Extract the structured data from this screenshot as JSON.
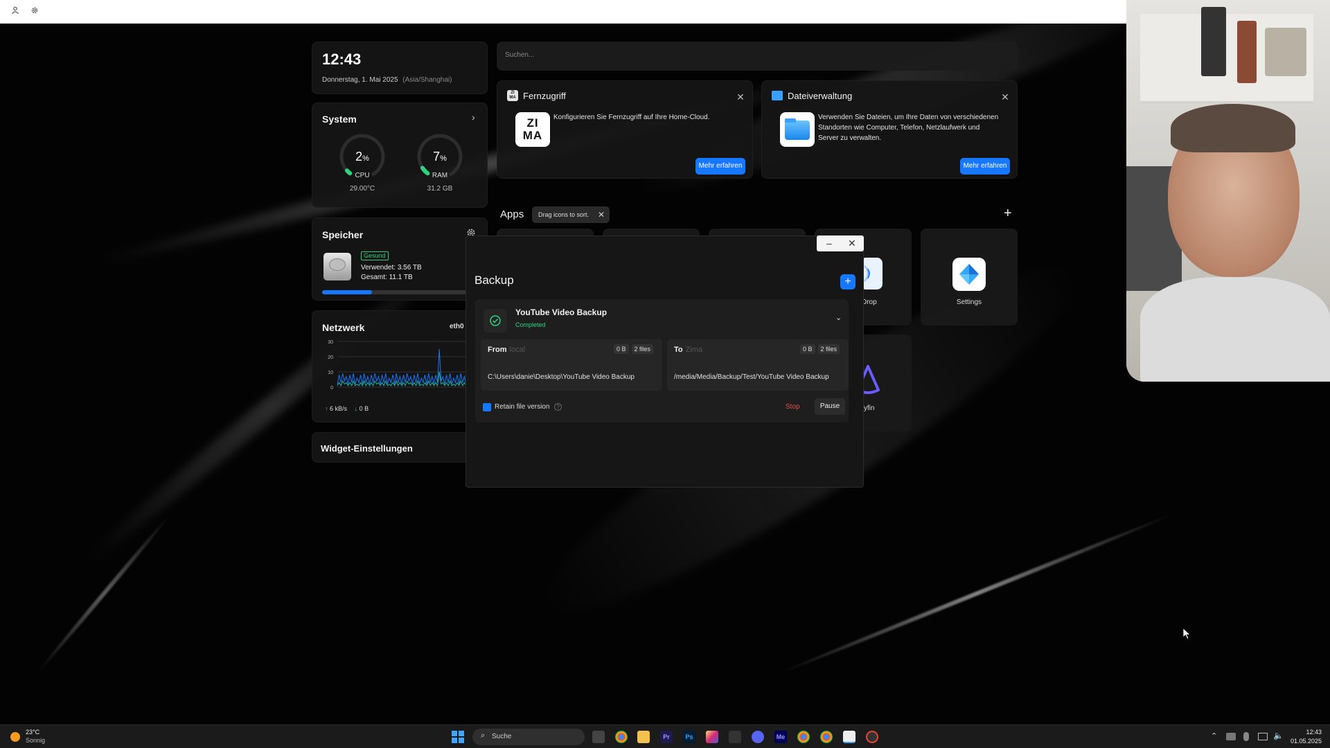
{
  "clock": {
    "time": "12:43",
    "date": "Donnerstag, 1. Mai 2025",
    "tz": "(Asia/Shanghai)"
  },
  "system": {
    "title": "System",
    "cpu": {
      "value": "2",
      "unit": "%",
      "label": "CPU",
      "sub": "29.00°C",
      "percent": 2
    },
    "ram": {
      "value": "7",
      "unit": "%",
      "label": "RAM",
      "sub": "31.2 GB",
      "percent": 7
    }
  },
  "storage": {
    "title": "Speicher",
    "health": "Gesund",
    "used": "Verwendet: 3.56 TB",
    "total": "Gesamt: 11.1 TB",
    "used_fraction": 0.32
  },
  "network": {
    "title": "Netzwerk",
    "iface": "eth0",
    "y_ticks": [
      "30",
      "20",
      "10",
      "0"
    ],
    "up": "6 kB/s",
    "down": "0 B",
    "chart_data": {
      "type": "line",
      "ylim": [
        0,
        30
      ],
      "series": [
        {
          "values": [
            2,
            8,
            3,
            9,
            4,
            7,
            2,
            8,
            3,
            9,
            2,
            6,
            3,
            8,
            2,
            9,
            3,
            7,
            2,
            8,
            3,
            9,
            4,
            7,
            2,
            8,
            3,
            9,
            2,
            6,
            3,
            8,
            2,
            9,
            3,
            7,
            2,
            8,
            3,
            9,
            4,
            7,
            2,
            8,
            3,
            9,
            2,
            6,
            3,
            8,
            2,
            9,
            3,
            7,
            2,
            8,
            3,
            25,
            4,
            7,
            2,
            8,
            3,
            9,
            2,
            6,
            3,
            8,
            2,
            9,
            3,
            7,
            2,
            8,
            3,
            9,
            4,
            7,
            2,
            8
          ]
        },
        {
          "values": [
            1,
            3,
            1,
            4,
            2,
            3,
            1,
            3,
            1,
            4,
            1,
            2,
            1,
            3,
            1,
            4,
            1,
            3,
            1,
            3,
            1,
            4,
            2,
            3,
            1,
            3,
            1,
            4,
            1,
            2,
            1,
            3,
            1,
            4,
            1,
            3,
            1,
            3,
            1,
            4,
            2,
            3,
            1,
            3,
            1,
            4,
            1,
            2,
            1,
            3,
            1,
            4,
            1,
            3,
            1,
            3,
            1,
            10,
            2,
            3,
            1,
            3,
            1,
            4,
            1,
            2,
            1,
            3,
            1,
            4,
            1,
            3,
            1,
            3,
            1,
            4,
            2,
            3,
            1,
            3
          ]
        }
      ]
    }
  },
  "widget_settings": "Widget-Einstellungen",
  "search": {
    "placeholder": "Suchen..."
  },
  "cards": [
    {
      "title": "Fernzugriff",
      "desc": "Konfigurieren Sie Fernzugriff auf Ihre Home-Cloud.",
      "button": "Mehr erfahren",
      "logo_top": "ZI",
      "logo_bottom": "MA"
    },
    {
      "title": "Dateiverwaltung",
      "desc_lines": [
        "Verwenden Sie Dateien, um Ihre Daten von verschiedenen",
        "Standorten wie Computer, Telefon, Netzlaufwerk und",
        "Server zu verwalten."
      ],
      "button": "Mehr erfahren"
    }
  ],
  "apps": {
    "title": "Apps",
    "hint": "Drag icons to sort.",
    "partial_drop": "Drop",
    "partial_jelly": "yfin",
    "settings": "Settings"
  },
  "backup": {
    "title": "Backup",
    "task_name": "YouTube Video Backup",
    "status": "Completed",
    "from": {
      "label": "From",
      "type": "local",
      "size": "0 B",
      "files": "2 files",
      "path": "C:\\Users\\danie\\Desktop\\YouTube Video Backup"
    },
    "to": {
      "label": "To",
      "type": "Zima",
      "size": "0 B",
      "files": "2 files",
      "path": "/media/Media/Backup/Test/YouTube Video Backup"
    },
    "retain": "Retain file version",
    "stop": "Stop",
    "pause": "Pause"
  },
  "taskbar": {
    "temp": "23°C",
    "weather": "Sonnig",
    "search": "Suche",
    "time": "12:43",
    "date": "01.05.2025"
  },
  "colors": {
    "accent": "#1677ff",
    "ok": "#2fd37f",
    "stop": "#e05050",
    "teal": "#1fb5a0"
  }
}
